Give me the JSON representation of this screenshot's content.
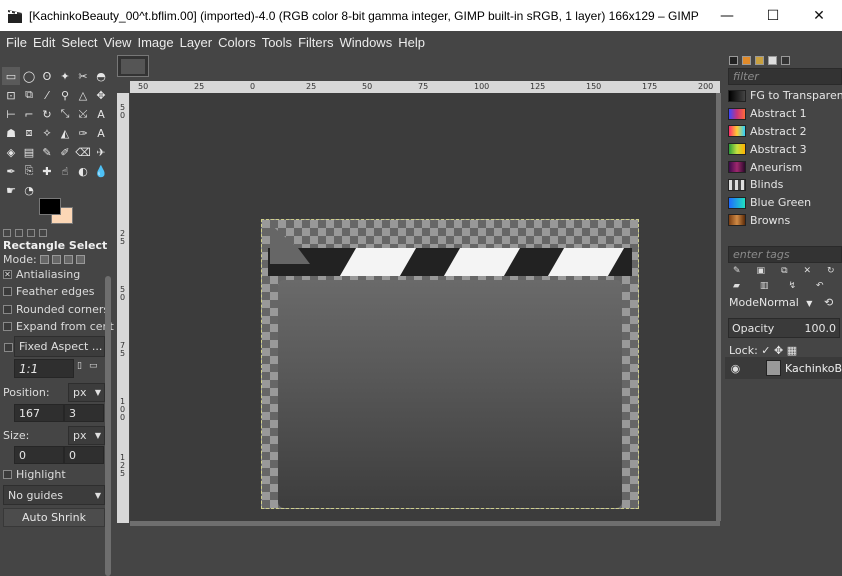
{
  "window": {
    "title": "[KachinkoBeauty_00^t.bflim.00] (imported)-4.0 (RGB color 8-bit gamma integer, GIMP built-in sRGB, 1 layer) 166x129 – GIMP",
    "minimize": "—",
    "maximize": "☐",
    "close": "✕"
  },
  "menu": [
    "File",
    "Edit",
    "Select",
    "View",
    "Image",
    "Layer",
    "Colors",
    "Tools",
    "Filters",
    "Windows",
    "Help"
  ],
  "colors": {
    "fg": "#000000",
    "bg": "#fcd7b6",
    "accent": "#cfcf8a"
  },
  "tool_options": {
    "title": "Rectangle Select",
    "mode_label": "Mode:",
    "antialiasing": "Antialiasing",
    "feather": "Feather edges",
    "rounded": "Rounded corners",
    "expand": "Expand from cente",
    "fixed": "Fixed Aspect ...",
    "ratio": "1:1",
    "position_label": "Position:",
    "position_unit": "px",
    "pos_x": "167",
    "pos_y": "3",
    "size_label": "Size:",
    "size_unit": "px",
    "size_w": "0",
    "size_h": "0",
    "highlight": "Highlight",
    "guides": "No guides",
    "auto_shrink": "Auto Shrink"
  },
  "ruler": {
    "h_ticks": [
      "50",
      "25",
      "0",
      "25",
      "50",
      "75",
      "100",
      "125",
      "150",
      "175",
      "200"
    ],
    "v_ticks": [
      "5",
      "0",
      "2",
      "5",
      "5",
      "0",
      "7",
      "5",
      "1",
      "0",
      "0",
      "1",
      "2",
      "5"
    ]
  },
  "gradients": {
    "filter_placeholder": "filter",
    "items": [
      {
        "name": "FG to Transparen",
        "swatch": "linear-gradient(90deg,#000,#444)"
      },
      {
        "name": "Abstract 1",
        "swatch": "linear-gradient(90deg,#3b48ff,#c8347a,#ff6a3a)"
      },
      {
        "name": "Abstract 2",
        "swatch": "linear-gradient(90deg,#ff2b6b,#ffcc33,#2bd1ff)"
      },
      {
        "name": "Abstract 3",
        "swatch": "linear-gradient(90deg,#2a9e3a,#c4e040,#ffb000)"
      },
      {
        "name": "Aneurism",
        "swatch": "linear-gradient(90deg,#3b0a4a,#a0286e,#2a0a2a)"
      },
      {
        "name": "Blinds",
        "swatch": "repeating-linear-gradient(90deg,#ddd 0 3px,#444 3px 6px)"
      },
      {
        "name": "Blue Green",
        "swatch": "linear-gradient(90deg,#1e6bff,#20e0c0)"
      },
      {
        "name": "Browns",
        "swatch": "linear-gradient(90deg,#7a3e12,#d08a45,#5a2a08)"
      }
    ],
    "tags_placeholder": "enter tags"
  },
  "layers": {
    "mode_label": "Mode",
    "mode_value": "Normal",
    "opacity_label": "Opacity",
    "opacity_value": "100.0",
    "lock_label": "Lock:",
    "layer_name": "KachinkoB"
  }
}
